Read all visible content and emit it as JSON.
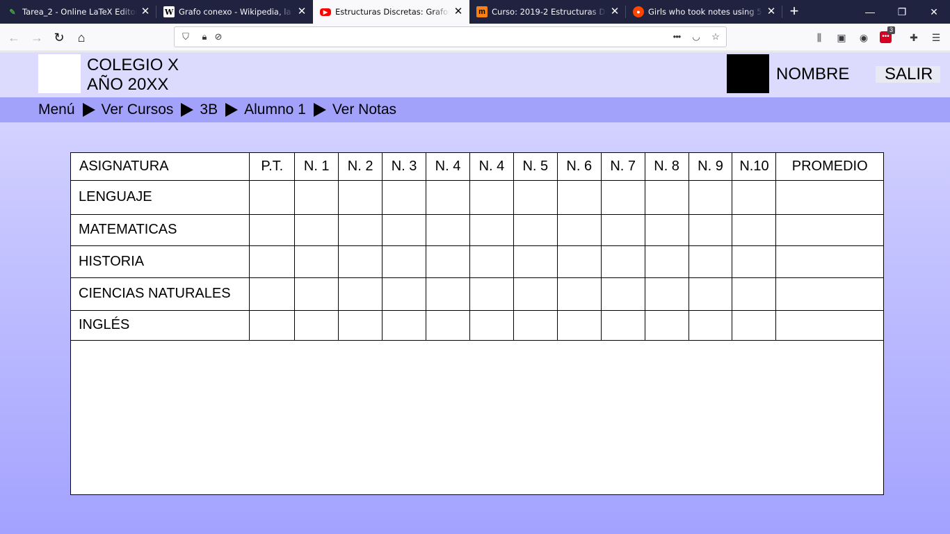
{
  "browser": {
    "tabs": [
      {
        "title": "Tarea_2 - Online LaTeX Editor O",
        "icon": "overleaf-icon",
        "active": false
      },
      {
        "title": "Grafo conexo - Wikipedia, la en",
        "icon": "wikipedia-icon",
        "active": false
      },
      {
        "title": "Estructuras Discretas: Grafos es",
        "icon": "youtube-icon",
        "active": true
      },
      {
        "title": "Curso: 2019-2 Estructuras Discr",
        "icon": "moodle-icon",
        "active": false
      },
      {
        "title": "Girls who took notes using 50 d",
        "icon": "reddit-icon",
        "active": false
      }
    ],
    "url": "",
    "extension_badge": "3"
  },
  "header": {
    "school_name": "COLEGIO X",
    "year": "AÑO 20XX",
    "user_name": "NOMBRE",
    "logout_label": "SALIR"
  },
  "breadcrumb": {
    "items": [
      "Menú",
      "Ver Cursos",
      "3B",
      "Alumno 1",
      "Ver Notas"
    ]
  },
  "grades_table": {
    "columns": [
      "ASIGNATURA",
      "P.T.",
      "N. 1",
      "N. 2",
      "N. 3",
      "N. 4",
      "N. 4",
      "N. 5",
      "N. 6",
      "N. 7",
      "N. 8",
      "N. 9",
      "N.10",
      "PROMEDIO"
    ],
    "rows": [
      {
        "subject": "LENGUAJE"
      },
      {
        "subject": "MATEMATICAS"
      },
      {
        "subject": "HISTORIA"
      },
      {
        "subject": "CIENCIAS NATURALES"
      },
      {
        "subject": "INGLÉS"
      }
    ]
  },
  "colors": {
    "header_bg": "#dcdbfd",
    "breadcrumb_bg": "#a3a2fb",
    "page_gradient_bottom": "#a3a2ff"
  }
}
